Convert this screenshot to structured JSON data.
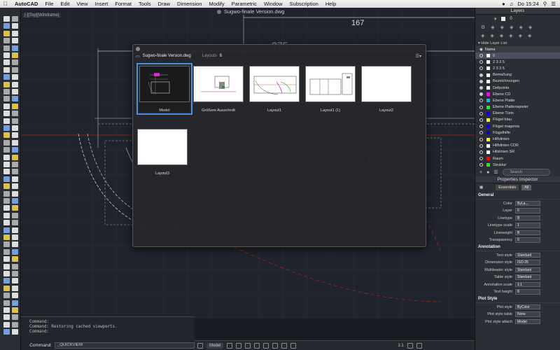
{
  "menubar": {
    "app": "AutoCAD",
    "items": [
      "File",
      "Edit",
      "View",
      "Insert",
      "Format",
      "Tools",
      "Draw",
      "Dimension",
      "Modify",
      "Parametric",
      "Window",
      "Subscription",
      "Help"
    ],
    "clock": "Do 15:24"
  },
  "document": {
    "title": "Sugwo-finale Version.dwg",
    "viewport_label": "[-][Top][Wireframe]"
  },
  "dimensions": {
    "d1": "167",
    "d2": "275"
  },
  "layouts_dialog": {
    "filename": "Sugwo-finale Version.dwg",
    "layouts_label": "Layouts",
    "layouts_count": "6",
    "thumbnails": [
      {
        "caption": "Model"
      },
      {
        "caption": "Größere Ausschnitt"
      },
      {
        "caption": "Layout1"
      },
      {
        "caption": "Layout1 (1)"
      },
      {
        "caption": "Layout2"
      },
      {
        "caption": "Layout3"
      }
    ]
  },
  "command_line": {
    "history": [
      "Command:",
      "Command: Restoring cached viewports.",
      "Command:"
    ],
    "label": "Command:",
    "input_value": "_QUICKVIEW"
  },
  "statusbar": {
    "model_tab": "Model",
    "scale": "1:1"
  },
  "layers_panel": {
    "title": "Layers",
    "current_layer": "0",
    "hide_list": "Hide Layer List",
    "name_header": "Name",
    "search_placeholder": "Search",
    "layers": [
      {
        "name": "0",
        "color": "#ffffff"
      },
      {
        "name": "2 3 3 5",
        "color": "#ffffff"
      },
      {
        "name": "2 3 3 5",
        "color": "#ffffff"
      },
      {
        "name": "Bemaßung",
        "color": "#ffffff"
      },
      {
        "name": "Bezeichnungen",
        "color": "#ffffff"
      },
      {
        "name": "Defpoints",
        "color": "#ffffff"
      },
      {
        "name": "Ebene CD",
        "color": "#ff00ff"
      },
      {
        "name": "Ebene Platte",
        "color": "#00bfff"
      },
      {
        "name": "Ebene Plattenspieler",
        "color": "#00ff00"
      },
      {
        "name": "Ebene Türin",
        "color": "#0000ff"
      },
      {
        "name": "Flügel blau",
        "color": "#ffff00"
      },
      {
        "name": "Flügel magenta",
        "color": "#0000ff"
      },
      {
        "name": "Flügelhilfe",
        "color": "#0000ff"
      },
      {
        "name": "Hilfslinien",
        "color": "#ffff00"
      },
      {
        "name": "Hilfslinien CDR",
        "color": "#ffffff"
      },
      {
        "name": "Hilslinien SR",
        "color": "#ffffff"
      },
      {
        "name": "Raum",
        "color": "#ff0000"
      },
      {
        "name": "Struktur",
        "color": "#00ff00"
      }
    ]
  },
  "properties_panel": {
    "title": "Properties Inspector",
    "tab_essentials": "Essentials",
    "tab_all": "All",
    "general": {
      "header": "General",
      "rows": [
        {
          "label": "Color",
          "value": "ByLa..."
        },
        {
          "label": "Layer",
          "value": "0"
        },
        {
          "label": "Linetype",
          "value": "B"
        },
        {
          "label": "Linetype scale",
          "value": "1"
        },
        {
          "label": "Lineweight",
          "value": "B"
        },
        {
          "label": "Transparency",
          "value": "0"
        }
      ]
    },
    "annotation": {
      "header": "Annotation",
      "rows": [
        {
          "label": "Text style",
          "value": "Standard"
        },
        {
          "label": "Dimension style",
          "value": "ISO-25"
        },
        {
          "label": "Multileader style",
          "value": "Standard"
        },
        {
          "label": "Table style",
          "value": "Standard"
        },
        {
          "label": "Annotation scale",
          "value": "1:1"
        },
        {
          "label": "Text height",
          "value": "8"
        }
      ]
    },
    "plot_style": {
      "header": "Plot Style",
      "rows": [
        {
          "label": "Plot style",
          "value": "ByColor"
        },
        {
          "label": "Plot style table",
          "value": "None"
        },
        {
          "label": "Plot style attach",
          "value": "Model"
        }
      ]
    }
  }
}
